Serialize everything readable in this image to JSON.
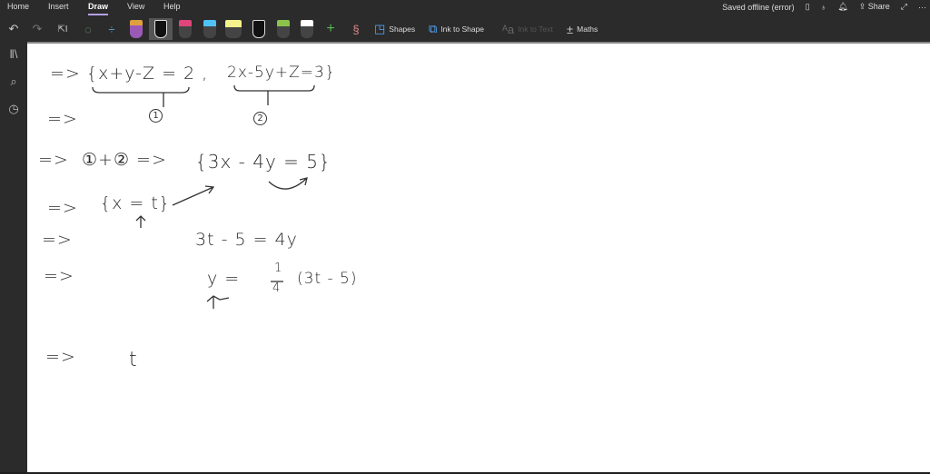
{
  "menu": {
    "tabs": [
      "Home",
      "Insert",
      "Draw",
      "View",
      "Help"
    ],
    "active": "Draw"
  },
  "toolbar": {
    "shapes": "Shapes",
    "ink_to_shape": "Ink to Shape",
    "ink_to_text": "Ink to Text",
    "maths": "Maths",
    "pen_colors": [
      "#9b59b6",
      "#111111",
      "#e0457b",
      "#4fc3f7",
      "#f4f28a",
      "#111111",
      "#8bc34a",
      "#ffffff"
    ]
  },
  "status": {
    "saved": "Saved offline (error)",
    "share": "Share"
  },
  "ink": {
    "arrows": [
      "=>",
      "=>",
      "=>",
      "=>",
      "=>",
      "=>",
      "=>"
    ],
    "eq1": "{x+y-Z = 2 ,",
    "eq2": "2x-5y+Z=3}",
    "c1": "1",
    "c2": "2",
    "sum": "①+② =>",
    "combined": "{3x - 4y = 5}",
    "param": "{x = t}",
    "rearr": "3t - 5 = 4y",
    "y_lhs": "y  =",
    "frac_num": "1",
    "frac_den": "4",
    "y_rhs": "(3t - 5)",
    "t": "t"
  }
}
